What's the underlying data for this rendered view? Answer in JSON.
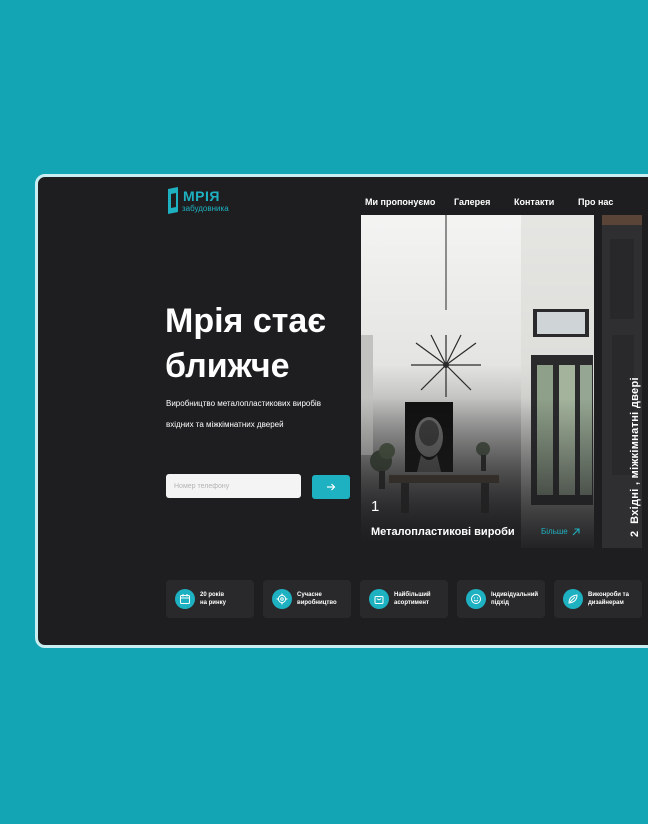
{
  "logo": {
    "title": "МРІЯ",
    "subtitle": "забудовника"
  },
  "nav": {
    "items": [
      "Ми пропонуємо",
      "Галерея",
      "Контакти",
      "Про нас"
    ]
  },
  "hero": {
    "title_line1": "Мрія стає",
    "title_line2": "ближче",
    "subtitle_line1": "Виробництво металопластикових виробів",
    "subtitle_line2": "вхідних та міжкімнатних дверей"
  },
  "form": {
    "phone_placeholder": "Номер телефону",
    "submit_icon": "arrow-right-icon"
  },
  "cards": {
    "main": {
      "number": "1",
      "title": "Металопластикові вироби",
      "more_label": "Більше"
    },
    "side": {
      "number": "2",
      "label": "Вхідні , міжкімнатні двері"
    }
  },
  "features": [
    {
      "label_line1": "20 років",
      "label_line2": "на ринку",
      "icon": "calendar-icon"
    },
    {
      "label_line1": "Сучасне",
      "label_line2": "виробництво",
      "icon": "gear-icon"
    },
    {
      "label_line1": "Найбільший",
      "label_line2": "асортимент",
      "icon": "shopping-bag-icon"
    },
    {
      "label_line1": "Індивідуальний",
      "label_line2": "підхід",
      "icon": "smile-icon"
    },
    {
      "label_line1": "Виконроби та",
      "label_line2": "дизайнерам",
      "icon": "leaf-icon"
    }
  ],
  "colors": {
    "background": "#13a5b4",
    "panel": "#1e1e20",
    "accent": "#1eb1c1",
    "text": "#ffffff"
  }
}
